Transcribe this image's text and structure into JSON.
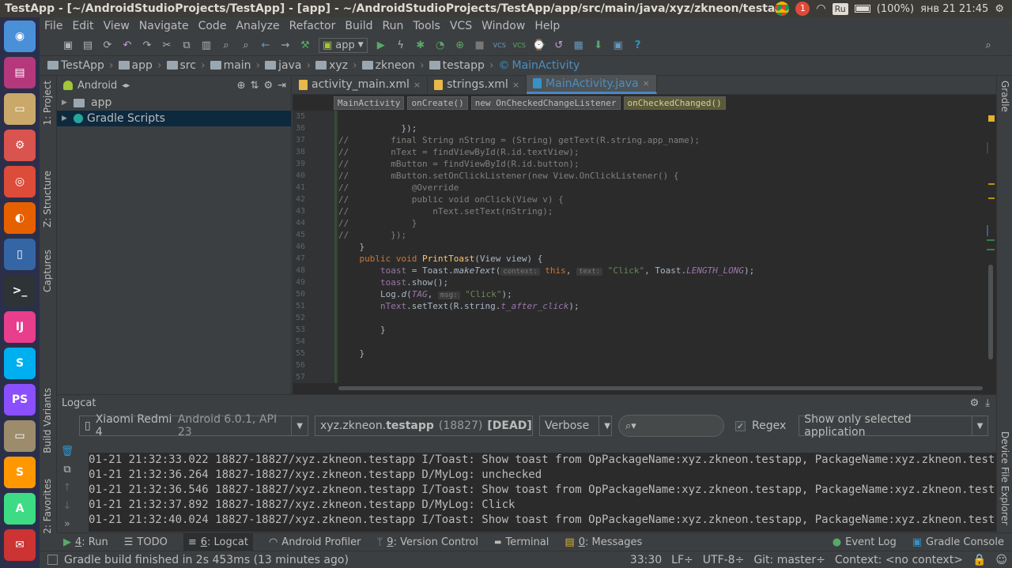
{
  "system": {
    "window_title": "TestApp - [~/AndroidStudioProjects/TestApp] - [app] - ~/AndroidStudioProjects/TestApp/app/src/main/java/xyz/zkneon/testapp/MainA",
    "notification_count": "1",
    "keyboard_layout": "Ru",
    "battery": "(100%)",
    "clock": "янв 21 21:45"
  },
  "launcher": [
    {
      "name": "dash-icon",
      "glyph": "◉",
      "color": "#4a90d9"
    },
    {
      "name": "software-center-icon",
      "glyph": "▤",
      "color": "#b5377c"
    },
    {
      "name": "files-icon",
      "glyph": "▭",
      "color": "#c9a86a"
    },
    {
      "name": "settings-icon",
      "glyph": "⚙",
      "color": "#d9534f"
    },
    {
      "name": "chrome-icon",
      "glyph": "◎",
      "color": "#dd4b39"
    },
    {
      "name": "firefox-icon",
      "glyph": "◐",
      "color": "#e66000"
    },
    {
      "name": "device-icon",
      "glyph": "▯",
      "color": "#3465a4"
    },
    {
      "name": "terminal-icon",
      "glyph": ">_",
      "color": "#2e3436"
    },
    {
      "name": "intellij-icon",
      "glyph": "IJ",
      "color": "#e83e8c"
    },
    {
      "name": "skype-icon",
      "glyph": "S",
      "color": "#00aff0"
    },
    {
      "name": "phpstorm-icon",
      "glyph": "PS",
      "color": "#8a4fff"
    },
    {
      "name": "archive-icon",
      "glyph": "▭",
      "color": "#9c8c6c"
    },
    {
      "name": "sublime-icon",
      "glyph": "S",
      "color": "#ff9800"
    },
    {
      "name": "android-studio-icon",
      "glyph": "A",
      "color": "#3ddc84"
    },
    {
      "name": "mail-icon",
      "glyph": "✉",
      "color": "#cc3333"
    }
  ],
  "menu": [
    "File",
    "Edit",
    "View",
    "Navigate",
    "Code",
    "Analyze",
    "Refactor",
    "Build",
    "Run",
    "Tools",
    "VCS",
    "Window",
    "Help"
  ],
  "toolbar": {
    "run_config": "app"
  },
  "navbar": {
    "crumbs": [
      "TestApp",
      "app",
      "src",
      "main",
      "java",
      "xyz",
      "zkneon",
      "testapp"
    ],
    "class": "MainActivity"
  },
  "left_tabs": [
    "1: Project",
    "Z: Structure",
    "Captures",
    "Build Variants",
    "2: Favorites"
  ],
  "right_tabs": [
    "Gradle",
    "Device File Explorer"
  ],
  "project": {
    "view": "Android",
    "items": [
      {
        "label": "app",
        "selected": false
      },
      {
        "label": "Gradle Scripts",
        "selected": true
      }
    ]
  },
  "editor": {
    "tabs": [
      {
        "label": "activity_main.xml",
        "active": false,
        "icon_color": "#e8b84a"
      },
      {
        "label": "strings.xml",
        "active": false,
        "icon_color": "#e8b84a"
      },
      {
        "label": "MainActivity.java",
        "active": true,
        "icon_color": "#3592c4"
      }
    ],
    "crumbs": [
      "MainActivity",
      "onCreate()",
      "new OnCheckedChangeListener",
      "onCheckedChanged()"
    ],
    "line_numbers": [
      "35",
      "36",
      "37",
      "38",
      "39",
      "40",
      "41",
      "42",
      "43",
      "44",
      "45",
      "46",
      "47",
      "48",
      "49",
      "50",
      "51",
      "52",
      "53",
      "54",
      "55",
      "56",
      "57"
    ],
    "code": {
      "l35": "",
      "l36": "            });",
      "l37c": "//        ",
      "l37": "final String nString = (String) getText(R.string.app_name);",
      "l38c": "//        ",
      "l38": "nText = findViewById(R.id.textView);",
      "l39c": "//        ",
      "l39": "mButton = findViewById(R.id.button);",
      "l40c": "//        ",
      "l40": "mButton.setOnClickListener(new View.OnClickListener() {",
      "l41c": "//            ",
      "l41": "@Override",
      "l42c": "//            ",
      "l42": "public void onClick(View v) {",
      "l43c": "//                ",
      "l43": "nText.setText(nString);",
      "l44c": "//            ",
      "l44": "}",
      "l45c": "//        ",
      "l45": "});",
      "l46": "    }",
      "l47_kw1": "public void ",
      "l47_fn": "PrintToast",
      "l47_rest": "(View view) {",
      "l48_f": "toast",
      "l48_a": " = Toast.",
      "l48_m": "makeText",
      "l48_b": "(",
      "l48_h1": "context:",
      "l48_kw": " this",
      "l48_c": ", ",
      "l48_h2": "text:",
      "l48_s": " \"Click\"",
      "l48_d": ", Toast.",
      "l48_const": "LENGTH_LONG",
      "l48_e": ");",
      "l49_f": "toast",
      "l49_a": ".show();",
      "l50_a": "Log.",
      "l50_m": "d",
      "l50_b": "(",
      "l50_tag": "TAG",
      "l50_c": ", ",
      "l50_h": "msg:",
      "l50_s": " \"Click\"",
      "l50_e": ");",
      "l51_f": "nText",
      "l51_a": ".setText(R.string.",
      "l51_res": "t_after_click",
      "l51_e": ");",
      "l53": "        }",
      "l55": "    }"
    }
  },
  "logcat": {
    "title": "Logcat",
    "device": "Xiaomi Redmi 4",
    "device_info": "Android 6.0.1, API 23",
    "process_prefix": "xyz.zkneon.",
    "process_name": "testapp",
    "process_pid": "(18827)",
    "process_state": "[DEAD]",
    "level": "Verbose",
    "search_placeholder": "",
    "regex_label": "Regex",
    "regex_checked": true,
    "filter": "Show only selected application",
    "lines": [
      "01-21 21:32:33.022 18827-18827/xyz.zkneon.testapp I/Toast: Show toast from OpPackageName:xyz.zkneon.testapp, PackageName:xyz.zkneon.test",
      "01-21 21:32:36.264 18827-18827/xyz.zkneon.testapp D/MyLog: unchecked",
      "01-21 21:32:36.546 18827-18827/xyz.zkneon.testapp I/Toast: Show toast from OpPackageName:xyz.zkneon.testapp, PackageName:xyz.zkneon.test",
      "01-21 21:32:37.892 18827-18827/xyz.zkneon.testapp D/MyLog: Click",
      "01-21 21:32:40.024 18827-18827/xyz.zkneon.testapp I/Toast: Show toast from OpPackageName:xyz.zkneon.testapp, PackageName:xyz.zkneon.test"
    ]
  },
  "bottom_tabs": {
    "run_num": "4",
    "run": ": Run",
    "todo": "TODO",
    "logcat_num": "6",
    "logcat": ": Logcat",
    "profiler": "Android Profiler",
    "vc_num": "9",
    "vc": ": Version Control",
    "terminal": "Terminal",
    "messages_num": "0",
    "messages": ": Messages",
    "event_log": "Event Log",
    "gradle_console": "Gradle Console"
  },
  "status": {
    "message": "Gradle build finished in 2s 453ms (13 minutes ago)",
    "position": "33:30",
    "line_sep": "LF÷",
    "encoding": "UTF-8÷",
    "git": "Git: master÷",
    "context": "Context: <no context>"
  }
}
